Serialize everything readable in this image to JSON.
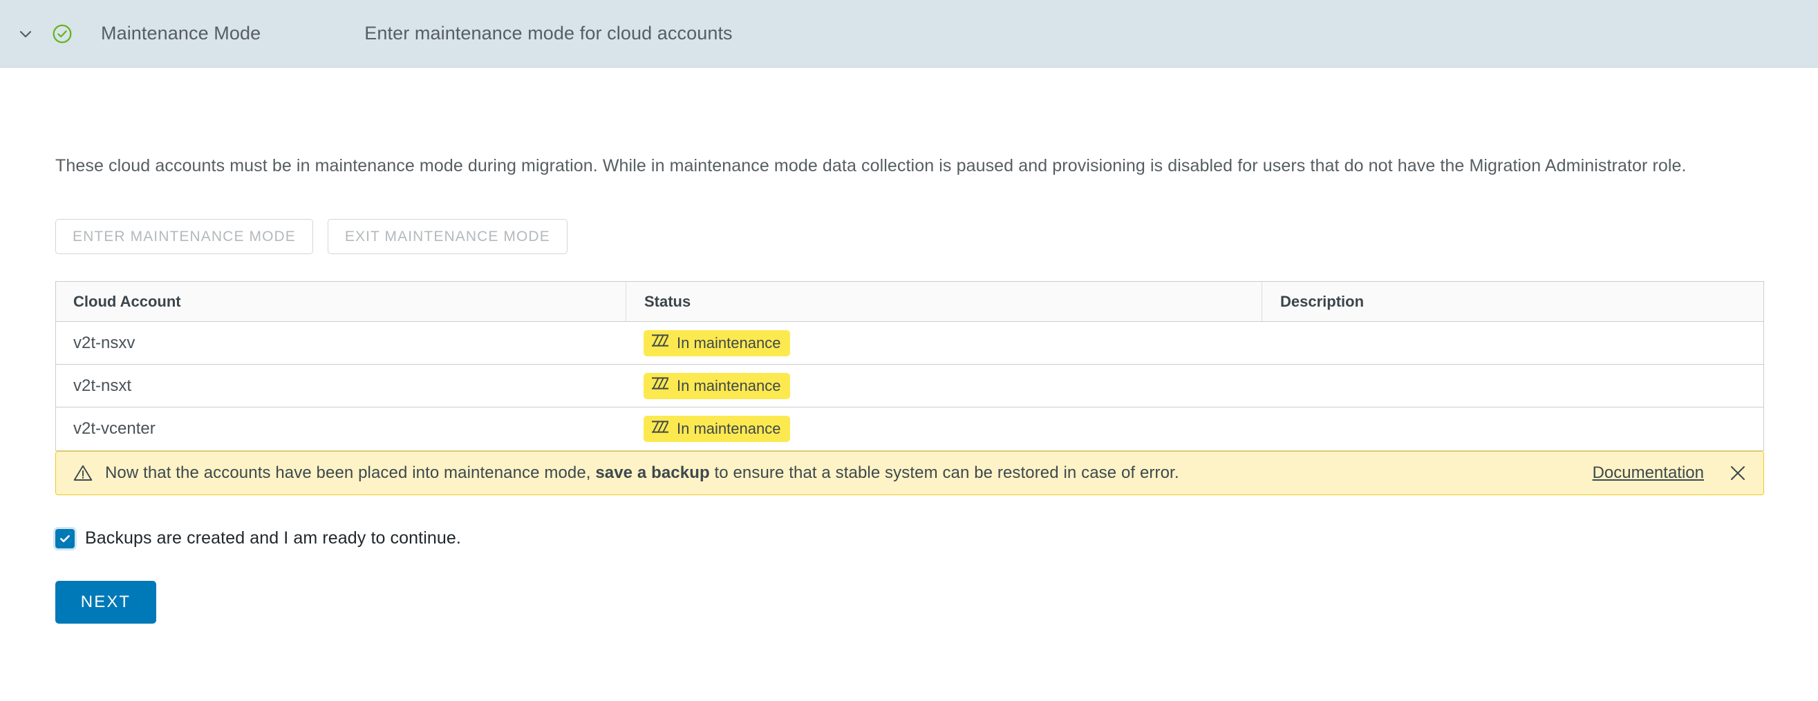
{
  "header": {
    "collapse_icon": "chevron-down-icon",
    "status_icon": "success-check-circle-icon",
    "step_title": "Maintenance Mode",
    "step_subtitle": "Enter maintenance mode for cloud accounts"
  },
  "main": {
    "intro_paragraph": "These cloud accounts must be in maintenance mode during migration. While in maintenance mode data collection is paused and provisioning is disabled for users that do not have the Migration Administrator role.",
    "actions": {
      "enter_maintenance_label": "ENTER MAINTENANCE MODE",
      "exit_maintenance_label": "EXIT MAINTENANCE MODE",
      "enter_maintenance_disabled": true,
      "exit_maintenance_disabled": true
    },
    "table": {
      "columns": [
        "Cloud Account",
        "Status",
        "Description"
      ],
      "rows": [
        {
          "account": "v2t-nsxv",
          "status": "In maintenance",
          "status_icon": "maintenance-hatch-icon",
          "description": ""
        },
        {
          "account": "v2t-nsxt",
          "status": "In maintenance",
          "status_icon": "maintenance-hatch-icon",
          "description": ""
        },
        {
          "account": "v2t-vcenter",
          "status": "In maintenance",
          "status_icon": "maintenance-hatch-icon",
          "description": ""
        }
      ]
    },
    "alert": {
      "icon": "warning-triangle-icon",
      "text_before": "Now that the accounts have been placed into maintenance mode, ",
      "text_bold": "save a backup",
      "text_after": " to ensure that a stable system can be restored in case of error.",
      "link_label": "Documentation",
      "close_icon": "close-icon"
    },
    "confirm_checkbox": {
      "checked": true,
      "label": "Backups are created and I am ready to continue."
    },
    "next_label": "NEXT"
  },
  "colors": {
    "header_bg": "#d8e3ea",
    "accent_blue": "#0079b8",
    "success_green": "#60b515",
    "badge_yellow": "#fce94f",
    "alert_bg": "#fdf3c6",
    "alert_border": "#efc91e"
  }
}
